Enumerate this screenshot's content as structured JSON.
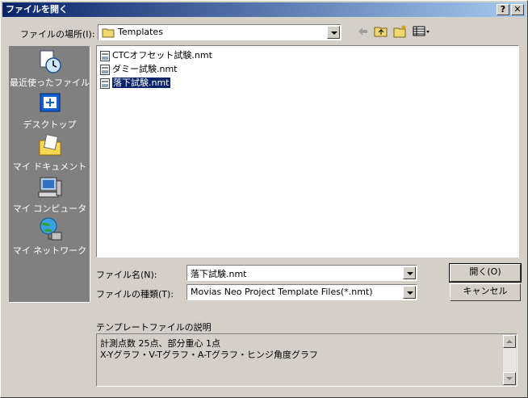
{
  "window": {
    "title": "ファイルを開く",
    "help_label": "?",
    "close_label": "✕"
  },
  "look_in": {
    "label": "ファイルの場所(I):",
    "value": "Templates"
  },
  "places": [
    {
      "label": "最近使ったファイル",
      "icon": "recent-files-icon"
    },
    {
      "label": "デスクトップ",
      "icon": "desktop-icon"
    },
    {
      "label": "マイ ドキュメント",
      "icon": "my-documents-icon"
    },
    {
      "label": "マイ コンピュータ",
      "icon": "my-computer-icon"
    },
    {
      "label": "マイ ネットワーク",
      "icon": "my-network-icon"
    }
  ],
  "files": [
    {
      "name": "CTCオフセット試験.nmt",
      "selected": false
    },
    {
      "name": "ダミー試験.nmt",
      "selected": false
    },
    {
      "name": "落下試験.nmt",
      "selected": true
    }
  ],
  "filename": {
    "label": "ファイル名(N):",
    "value": "落下試験.nmt"
  },
  "filetype": {
    "label": "ファイルの種類(T):",
    "value": "Movias Neo Project Template Files(*.nmt)"
  },
  "buttons": {
    "open": "開く(O)",
    "cancel": "キャンセル"
  },
  "description": {
    "label": "テンプレートファイルの説明",
    "line1": "計測点数  25点、部分重心 1点",
    "line2": "X-Yグラフ・V-Tグラフ・A-Tグラフ・ヒンジ角度グラフ"
  },
  "colors": {
    "titlebar_start": "#0a246a",
    "titlebar_end": "#a6caf0",
    "dialog_face": "#d4d0c8",
    "places_bar": "#808080",
    "selection": "#0a246a"
  }
}
